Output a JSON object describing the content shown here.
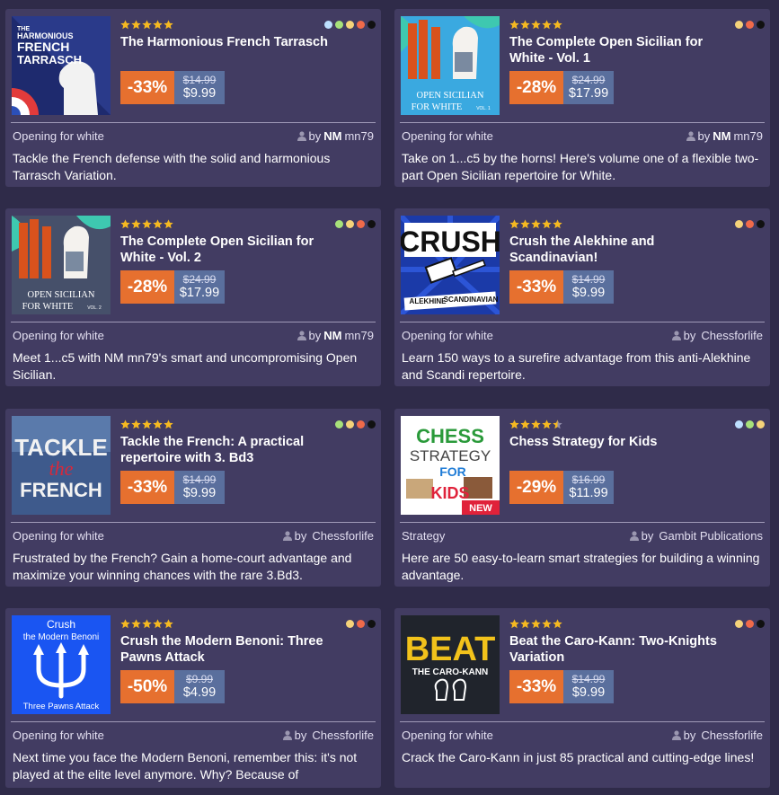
{
  "cards": [
    {
      "title": "The Harmonious French Tarrasch",
      "discount": "-33%",
      "old_price": "$14.99",
      "new_price": "$9.99",
      "category": "Opening for white",
      "by": "by",
      "author_title": "NM",
      "author": "mn79",
      "description": "Tackle the French defense with the solid and harmonious Tarrasch Variation.",
      "rating": 5,
      "level_dots": [
        "#bde0ff",
        "#a7e17a",
        "#f5d37a",
        "#ef6a4a",
        "#111111"
      ],
      "cover_text": [
        "THE",
        "HARMONIOUS",
        "FRENCH",
        "TARRASCH"
      ]
    },
    {
      "title": "The Complete Open Sicilian for White - Vol. 1",
      "discount": "-28%",
      "old_price": "$24.99",
      "new_price": "$17.99",
      "category": "Opening for white",
      "by": "by",
      "author_title": "NM",
      "author": "mn79",
      "description": "Take on 1...c5 by the horns! Here's volume one of a flexible two-part Open Sicilian repertoire for White.",
      "rating": 5,
      "level_dots": [
        "#f5d37a",
        "#ef6a4a",
        "#111111"
      ],
      "cover_text": [
        "OPEN SICILIAN",
        "FOR WHITE",
        "VOL. 1"
      ]
    },
    {
      "title": "The Complete Open Sicilian for White - Vol. 2",
      "discount": "-28%",
      "old_price": "$24.99",
      "new_price": "$17.99",
      "category": "Opening for white",
      "by": "by",
      "author_title": "NM",
      "author": "mn79",
      "description": "Meet 1...c5 with NM mn79's smart and uncompromising Open Sicilian.",
      "rating": 5,
      "level_dots": [
        "#a7e17a",
        "#f5d37a",
        "#ef6a4a",
        "#111111"
      ],
      "cover_text": [
        "OPEN SICILIAN",
        "FOR WHITE",
        "VOL. 2"
      ]
    },
    {
      "title": "Crush the Alekhine and Scandinavian!",
      "discount": "-33%",
      "old_price": "$14.99",
      "new_price": "$9.99",
      "category": "Opening for white",
      "by": "by",
      "author_title": "",
      "author": "Chessforlife",
      "description": "Learn 150 ways to a surefire advantage from this anti-Alekhine and Scandi repertoire.",
      "rating": 5,
      "level_dots": [
        "#f5d37a",
        "#ef6a4a",
        "#111111"
      ],
      "cover_text": [
        "CRUSH",
        "ALEKHINE",
        "SCANDINAVIAN"
      ]
    },
    {
      "title": "Tackle the French: A practical repertoire with 3. Bd3",
      "discount": "-33%",
      "old_price": "$14.99",
      "new_price": "$9.99",
      "category": "Opening for white",
      "by": "by",
      "author_title": "",
      "author": "Chessforlife",
      "description": "Frustrated by the French? Gain a home-court advantage and maximize your winning chances with the rare 3.Bd3.",
      "rating": 5,
      "level_dots": [
        "#a7e17a",
        "#f5d37a",
        "#ef6a4a",
        "#111111"
      ],
      "cover_text": [
        "TACKLE",
        "the",
        "FRENCH"
      ]
    },
    {
      "title": "Chess Strategy for Kids",
      "discount": "-29%",
      "old_price": "$16.99",
      "new_price": "$11.99",
      "category": "Strategy",
      "by": "by",
      "author_title": "",
      "author": "Gambit Publications",
      "description": "Here are 50 easy-to-learn smart strategies for building a winning advantage.",
      "rating": 4.5,
      "level_dots": [
        "#bde0ff",
        "#a7e17a",
        "#f5d37a"
      ],
      "cover_text": [
        "CHESS",
        "STRATEGY",
        "FOR",
        "KIDS",
        "NEW"
      ]
    },
    {
      "title": "Crush the Modern Benoni: Three Pawns Attack",
      "discount": "-50%",
      "old_price": "$9.99",
      "new_price": "$4.99",
      "category": "Opening for white",
      "by": "by",
      "author_title": "",
      "author": "Chessforlife",
      "description": "Next time you face the Modern Benoni, remember this: it's not played at the elite level anymore. Why? Because of",
      "rating": 5,
      "level_dots": [
        "#f5d37a",
        "#ef6a4a",
        "#111111"
      ],
      "cover_text": [
        "Crush",
        "the Modern Benoni",
        "Three Pawns Attack"
      ]
    },
    {
      "title": "Beat the Caro-Kann: Two-Knights Variation",
      "discount": "-33%",
      "old_price": "$14.99",
      "new_price": "$9.99",
      "category": "Opening for white",
      "by": "by",
      "author_title": "",
      "author": "Chessforlife",
      "description": "Crack the Caro-Kann in just 85 practical and cutting-edge lines!",
      "rating": 5,
      "level_dots": [
        "#f5d37a",
        "#ef6a4a",
        "#111111"
      ],
      "cover_text": [
        "BEAT",
        "THE CARO-KANN"
      ]
    }
  ]
}
